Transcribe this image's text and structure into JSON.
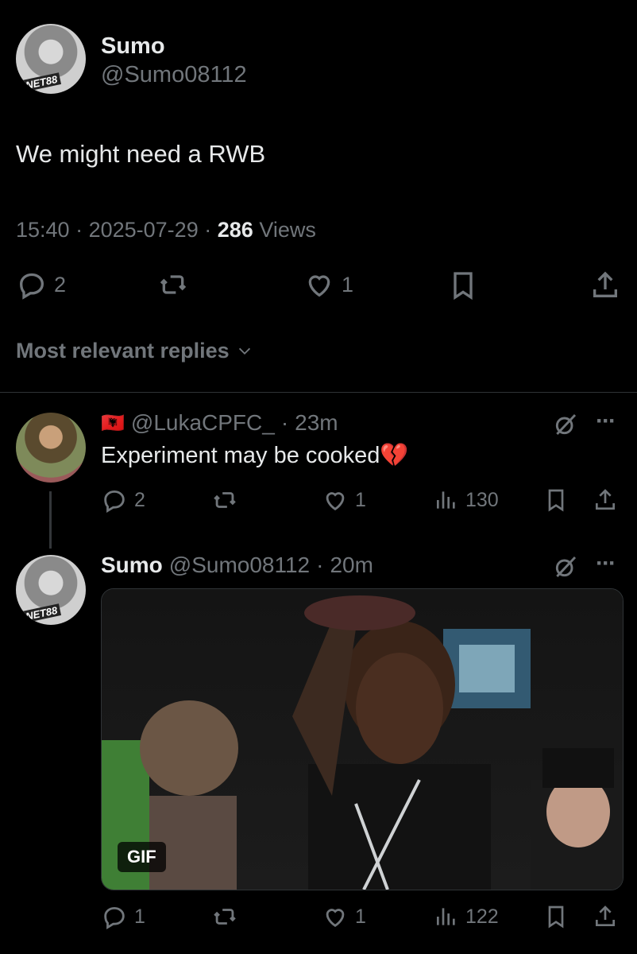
{
  "post": {
    "author_name": "Sumo",
    "author_handle": "@Sumo08112",
    "avatar_text": "NET88",
    "text": "We might need a RWB",
    "time": "15:40",
    "date": "2025-07-29",
    "views_count": "286",
    "views_label": "Views",
    "replies": "2",
    "likes": "1"
  },
  "sort_label": "Most relevant replies",
  "replies": [
    {
      "handle": "@LukaCPFC_",
      "time": "23m",
      "text": "Experiment may be cooked",
      "emoji": "💔",
      "flag": "🇦🇱",
      "replies": "2",
      "likes": "1",
      "views": "130"
    },
    {
      "name": "Sumo",
      "handle": "@Sumo08112",
      "time": "20m",
      "avatar_text": "NET88",
      "gif_label": "GIF",
      "replies": "1",
      "likes": "1",
      "views": "122"
    }
  ],
  "colors": {
    "background": "#000000",
    "text": "#e7e9ea",
    "muted": "#71767b",
    "divider": "#2f3336"
  }
}
